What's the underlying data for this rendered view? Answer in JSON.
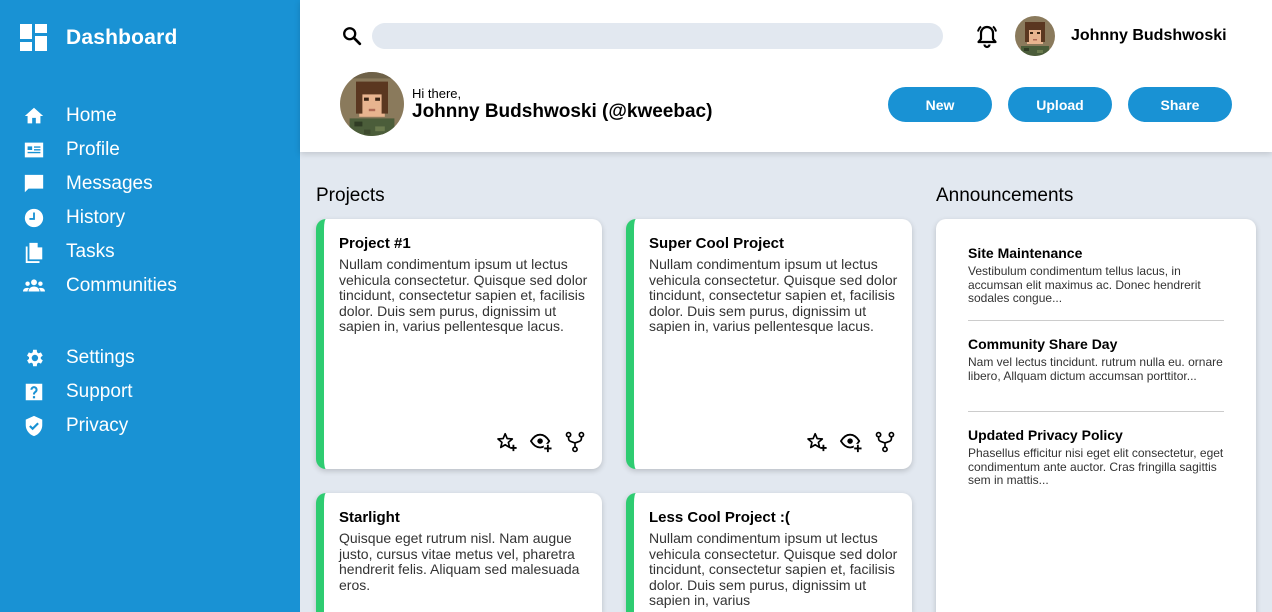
{
  "sidebar": {
    "brand_title": "Dashboard",
    "main_items": [
      {
        "label": "Home",
        "icon": "home-icon"
      },
      {
        "label": "Profile",
        "icon": "profile-card-icon"
      },
      {
        "label": "Messages",
        "icon": "message-icon"
      },
      {
        "label": "History",
        "icon": "clock-icon"
      },
      {
        "label": "Tasks",
        "icon": "document-icon"
      },
      {
        "label": "Communities",
        "icon": "people-icon"
      }
    ],
    "secondary_items": [
      {
        "label": "Settings",
        "icon": "gear-icon"
      },
      {
        "label": "Support",
        "icon": "help-icon"
      },
      {
        "label": "Privacy",
        "icon": "shield-icon"
      }
    ]
  },
  "header": {
    "search_placeholder": "",
    "user_name": "Johnny Budshwoski",
    "greeting": "Hi there,",
    "full_name": "Johnny Budshwoski (@kweebac)",
    "buttons": {
      "new": "New",
      "upload": "Upload",
      "share": "Share"
    }
  },
  "projects": {
    "title": "Projects",
    "cards": [
      {
        "title": "Project #1",
        "description": "Nullam condimentum ipsum ut lectus vehicula consectetur. Quisque sed dolor tincidunt, consectetur sapien et, facilisis dolor. Duis sem purus, dignissim ut sapien in, varius pellentesque lacus."
      },
      {
        "title": "Super Cool Project",
        "description": "Nullam condimentum ipsum ut lectus vehicula consectetur. Quisque sed dolor tincidunt, consectetur sapien et, facilisis dolor. Duis sem purus, dignissim ut sapien in, varius pellentesque lacus."
      },
      {
        "title": "Starlight",
        "description": "Quisque eget rutrum nisl. Nam augue justo, cursus vitae metus vel, pharetra hendrerit felis. Aliquam sed malesuada eros."
      },
      {
        "title": "Less Cool Project :(",
        "description": "Nullam condimentum ipsum ut lectus vehicula consectetur. Quisque sed dolor tincidunt, consectetur sapien et, facilisis dolor. Duis sem purus, dignissim ut sapien in, varius"
      }
    ]
  },
  "announcements": {
    "title": "Announcements",
    "items": [
      {
        "title": "Site Maintenance",
        "body": "Vestibulum condimentum tellus lacus, in accumsan elit maximus ac. Donec hendrerit sodales congue..."
      },
      {
        "title": "Community Share Day",
        "body": "Nam vel lectus tincidunt. rutrum nulla eu. ornare libero, Allquam dictum accumsan porttitor..."
      },
      {
        "title": "Updated Privacy Policy",
        "body": "Phasellus efficitur nisi eget elit consectetur, eget condimentum ante auctor. Cras fringilla sagittis sem in mattis..."
      }
    ]
  },
  "colors": {
    "primary": "#1992d4",
    "accent": "#2ecc71",
    "background": "#e2e8f0"
  }
}
